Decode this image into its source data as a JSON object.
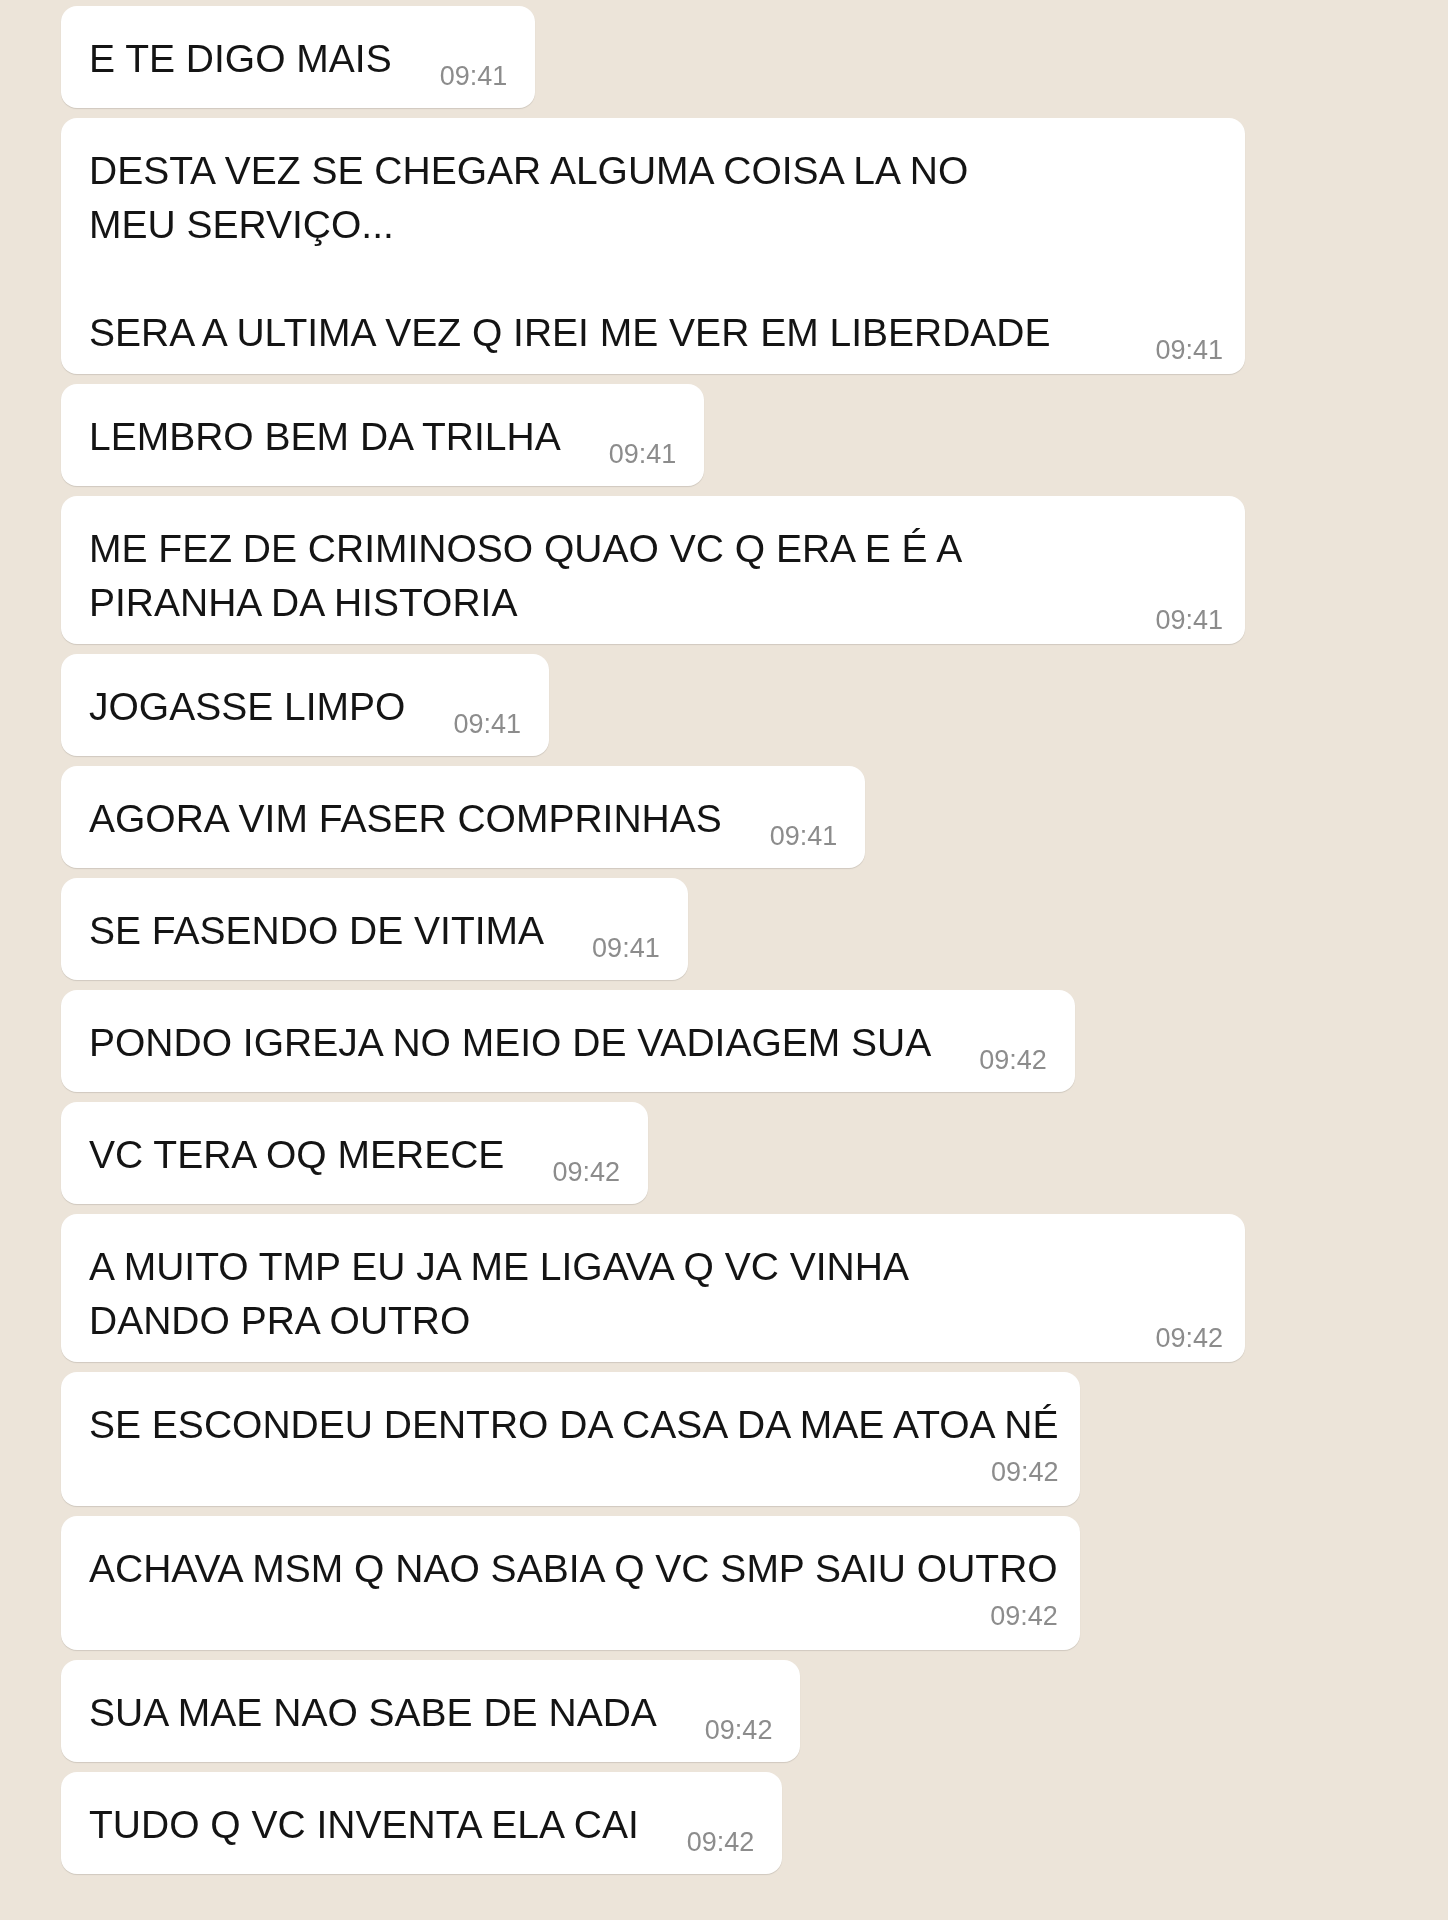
{
  "messages": [
    {
      "kind": "inline",
      "text": "E TE DIGO MAIS",
      "time": "09:41"
    },
    {
      "kind": "wrapped",
      "text": "DESTA VEZ SE CHEGAR ALGUMA COISA LA NO\nMEU SERVIÇO...\n\nSERA A ULTIMA VEZ Q IREI ME VER EM LIBERDADE",
      "time": "09:41"
    },
    {
      "kind": "inline",
      "text": "LEMBRO BEM DA TRILHA",
      "time": "09:41"
    },
    {
      "kind": "wrapped",
      "text": "ME FEZ DE CRIMINOSO QUAO VC Q ERA E É A\nPIRANHA DA HISTORIA",
      "time": "09:41"
    },
    {
      "kind": "inline",
      "text": "JOGASSE LIMPO",
      "time": "09:41"
    },
    {
      "kind": "inline",
      "text": "AGORA VIM FASER COMPRINHAS",
      "time": "09:41"
    },
    {
      "kind": "inline",
      "text": "SE FASENDO DE VITIMA",
      "time": "09:41"
    },
    {
      "kind": "inline",
      "text": "PONDO IGREJA NO MEIO DE VADIAGEM SUA",
      "time": "09:42"
    },
    {
      "kind": "inline",
      "text": "VC TERA OQ MERECE",
      "time": "09:42"
    },
    {
      "kind": "wrapped",
      "text": "A MUITO TMP EU JA ME LIGAVA Q VC VINHA\nDANDO PRA OUTRO",
      "time": "09:42"
    },
    {
      "kind": "stacked",
      "text": "SE ESCONDEU DENTRO DA CASA DA MAE ATOA NÉ",
      "time": "09:42"
    },
    {
      "kind": "stacked",
      "text": "ACHAVA MSM Q NAO SABIA Q VC SMP SAIU OUTRO",
      "time": "09:42"
    },
    {
      "kind": "inline",
      "text": "SUA MAE NAO SABE DE NADA",
      "time": "09:42"
    },
    {
      "kind": "inline",
      "text": "TUDO Q VC INVENTA ELA CAI",
      "time": "09:42"
    }
  ]
}
